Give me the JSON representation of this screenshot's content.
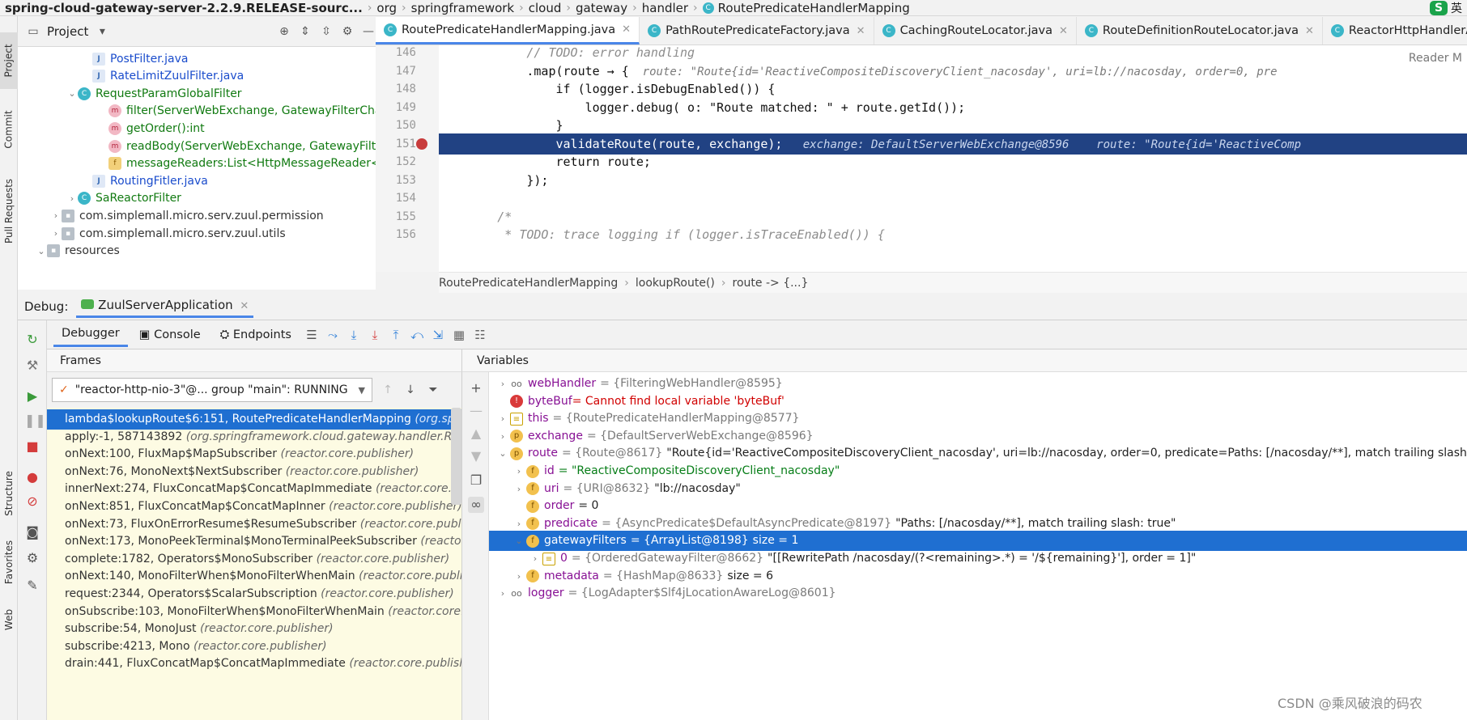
{
  "nav": {
    "project": "spring-cloud-gateway-server-2.2.9.RELEASE-sourc...",
    "crumbs": [
      "org",
      "springframework",
      "cloud",
      "gateway",
      "handler"
    ],
    "file": "RoutePredicateHandlerMapping",
    "brand_glyph": "S",
    "ime": "英"
  },
  "left_tabs": [
    "Project",
    "Commit",
    "Pull Requests",
    "Structure",
    "Favorites",
    "Web"
  ],
  "project_panel": {
    "title": "Project"
  },
  "tree": [
    {
      "label": "PostFilter.java",
      "icon": "java-file-icon",
      "color": "blue"
    },
    {
      "label": "RateLimitZuulFilter.java",
      "icon": "java-file-icon",
      "color": "blue"
    },
    {
      "label": "RequestParamGlobalFilter",
      "icon": "class-icon",
      "color": "green"
    },
    {
      "label": "filter(ServerWebExchange, GatewayFilterCha",
      "icon": "method-icon",
      "color": "green"
    },
    {
      "label": "getOrder():int",
      "icon": "method-icon",
      "color": "green"
    },
    {
      "label": "readBody(ServerWebExchange, GatewayFilte",
      "icon": "method-icon",
      "color": "green"
    },
    {
      "label": "messageReaders:List<HttpMessageReader<?",
      "icon": "field-icon",
      "color": "green"
    },
    {
      "label": "RoutingFitler.java",
      "icon": "java-file-icon",
      "color": "blue"
    },
    {
      "label": "SaReactorFilter",
      "icon": "class-icon",
      "color": "green"
    },
    {
      "label": "com.simplemall.micro.serv.zuul.permission",
      "icon": "package-icon",
      "color": "gray"
    },
    {
      "label": "com.simplemall.micro.serv.zuul.utils",
      "icon": "package-icon",
      "color": "gray"
    },
    {
      "label": "resources",
      "icon": "folder-icon",
      "color": "gray"
    }
  ],
  "editor_tabs": [
    {
      "label": "RoutePredicateHandlerMapping.java",
      "active": true
    },
    {
      "label": "PathRoutePredicateFactory.java",
      "active": false
    },
    {
      "label": "CachingRouteLocator.java",
      "active": false
    },
    {
      "label": "RouteDefinitionRouteLocator.java",
      "active": false
    },
    {
      "label": "ReactorHttpHandlerAdapter.java",
      "active": false
    }
  ],
  "reader_mode": "Reader M",
  "code": [
    {
      "n": "146",
      "code": "            // TODO: error handling",
      "hint": ""
    },
    {
      "n": "147",
      "code": "            .map(route → {",
      "hint": "  route: \"Route{id='ReactiveCompositeDiscoveryClient_nacosday', uri=lb://nacosday, order=0, pre"
    },
    {
      "n": "148",
      "code": "                if (logger.isDebugEnabled()) {",
      "hint": ""
    },
    {
      "n": "149",
      "code": "                    logger.debug( o: \"Route matched: \" + route.getId());",
      "hint": ""
    },
    {
      "n": "150",
      "code": "                }",
      "hint": ""
    },
    {
      "n": "151",
      "code": "                validateRoute(route, exchange);",
      "hint": "   exchange: DefaultServerWebExchange@8596    route: \"Route{id='ReactiveComp"
    },
    {
      "n": "152",
      "code": "                return route;",
      "hint": ""
    },
    {
      "n": "153",
      "code": "            });",
      "hint": ""
    },
    {
      "n": "154",
      "code": "",
      "hint": ""
    },
    {
      "n": "155",
      "code": "        /*",
      "hint": ""
    },
    {
      "n": "156",
      "code": "         * TODO: trace logging if (logger.isTraceEnabled()) {",
      "hint": ""
    }
  ],
  "editor_crumbs": [
    "RoutePredicateHandlerMapping",
    "lookupRoute()",
    "route -> {...}"
  ],
  "debug": {
    "label": "Debug:",
    "config": "ZuulServerApplication",
    "tabs": [
      "Debugger",
      "Console",
      "Endpoints"
    ],
    "frames_title": "Frames",
    "variables_title": "Variables",
    "thread": "\"reactor-http-nio-3\"@... group \"main\": RUNNING"
  },
  "frames": [
    {
      "m": "lambda$lookupRoute$6:151, RoutePredicateHandlerMapping",
      "p": "(org.spring"
    },
    {
      "m": "apply:-1, 587143892",
      "p": "(org.springframework.cloud.gateway.handler.RouteP"
    },
    {
      "m": "onNext:100, FluxMap$MapSubscriber",
      "p": "(reactor.core.publisher)"
    },
    {
      "m": "onNext:76, MonoNext$NextSubscriber",
      "p": "(reactor.core.publisher)"
    },
    {
      "m": "innerNext:274, FluxConcatMap$ConcatMapImmediate",
      "p": "(reactor.core.publi"
    },
    {
      "m": "onNext:851, FluxConcatMap$ConcatMapInner",
      "p": "(reactor.core.publisher)"
    },
    {
      "m": "onNext:73, FluxOnErrorResume$ResumeSubscriber",
      "p": "(reactor.core.publisher"
    },
    {
      "m": "onNext:173, MonoPeekTerminal$MonoTerminalPeekSubscriber",
      "p": "(reactor.c"
    },
    {
      "m": "complete:1782, Operators$MonoSubscriber",
      "p": "(reactor.core.publisher)"
    },
    {
      "m": "onNext:140, MonoFilterWhen$MonoFilterWhenMain",
      "p": "(reactor.core.publish"
    },
    {
      "m": "request:2344, Operators$ScalarSubscription",
      "p": "(reactor.core.publisher)"
    },
    {
      "m": "onSubscribe:103, MonoFilterWhen$MonoFilterWhenMain",
      "p": "(reactor.core.p"
    },
    {
      "m": "subscribe:54, MonoJust",
      "p": "(reactor.core.publisher)"
    },
    {
      "m": "subscribe:4213, Mono",
      "p": "(reactor.core.publisher)"
    },
    {
      "m": "drain:441, FluxConcatMap$ConcatMapImmediate",
      "p": "(reactor.core.publisher)"
    }
  ],
  "variables": [
    {
      "indent": 0,
      "arrow": "›",
      "icon": "oo",
      "name": "webHandler",
      "type": "= {FilteringWebHandler@8595}",
      "value": "",
      "err": ""
    },
    {
      "indent": 0,
      "arrow": "",
      "icon": "!",
      "name": "byteBuf",
      "type": "",
      "value": "",
      "err": "= Cannot find local variable 'byteBuf'"
    },
    {
      "indent": 0,
      "arrow": "›",
      "icon": "≡",
      "name": "this",
      "type": "= {RoutePredicateHandlerMapping@8577}",
      "value": "",
      "err": ""
    },
    {
      "indent": 0,
      "arrow": "›",
      "icon": "p",
      "name": "exchange",
      "type": "= {DefaultServerWebExchange@8596}",
      "value": "",
      "err": ""
    },
    {
      "indent": 0,
      "arrow": "⌄",
      "icon": "p",
      "name": "route",
      "type": "= {Route@8617}",
      "value": "\"Route{id='ReactiveCompositeDiscoveryClient_nacosday', uri=lb://nacosday, order=0, predicate=Paths: [/nacosday/**], match trailing slash: true, gate",
      "err": ""
    },
    {
      "indent": 1,
      "arrow": "›",
      "icon": "f",
      "name": "id",
      "type": "",
      "value": "",
      "err": "",
      "str": "= \"ReactiveCompositeDiscoveryClient_nacosday\""
    },
    {
      "indent": 1,
      "arrow": "›",
      "icon": "f",
      "name": "uri",
      "type": "= {URI@8632}",
      "value": "\"lb://nacosday\"",
      "err": ""
    },
    {
      "indent": 1,
      "arrow": "",
      "icon": "f",
      "name": "order",
      "type": "",
      "value": "= 0",
      "err": ""
    },
    {
      "indent": 1,
      "arrow": "›",
      "icon": "f",
      "name": "predicate",
      "type": "= {AsyncPredicate$DefaultAsyncPredicate@8197}",
      "value": "\"Paths: [/nacosday/**], match trailing slash: true\"",
      "err": ""
    },
    {
      "indent": 1,
      "arrow": "⌄",
      "icon": "f",
      "name": "gatewayFilters",
      "type": "= {ArrayList@8198}",
      "value": " size = 1",
      "err": "",
      "sel": true
    },
    {
      "indent": 2,
      "arrow": "›",
      "icon": "≡",
      "name": "0",
      "type": "= {OrderedGatewayFilter@8662}",
      "value": "\"[[RewritePath /nacosday/(?<remaining>.*) = '/${remaining}'], order = 1]\"",
      "err": ""
    },
    {
      "indent": 1,
      "arrow": "›",
      "icon": "f",
      "name": "metadata",
      "type": "= {HashMap@8633}",
      "value": " size = 6",
      "err": ""
    },
    {
      "indent": 0,
      "arrow": "›",
      "icon": "oo",
      "name": "logger",
      "type": "= {LogAdapter$Slf4jLocationAwareLog@8601}",
      "value": "",
      "err": ""
    }
  ],
  "watermark": "CSDN @乘风破浪的码农",
  "colors": {
    "accent": "#1f6fd1",
    "exec_line": "#214283",
    "frames_bg": "#fdfbe3"
  }
}
